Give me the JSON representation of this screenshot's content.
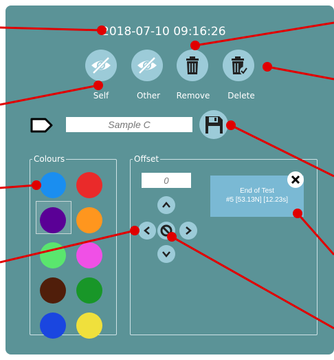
{
  "timestamp": "2018-07-10 09:16:26",
  "toolbar": {
    "self_label": "Self",
    "other_label": "Other",
    "remove_label": "Remove",
    "delete_label": "Delete",
    "self_icon": "eye-slash-icon",
    "other_icon": "eye-slash-icon",
    "remove_icon": "trash-icon",
    "delete_icon": "trash-check-icon"
  },
  "name": {
    "tag_icon": "tag-icon",
    "placeholder": "Sample C",
    "save_icon": "save-icon"
  },
  "colours": {
    "title": "Colours",
    "selected_index": 2,
    "swatches": [
      "#1a8ef0",
      "#ea2a2a",
      "#5a0096",
      "#ff961e",
      "#5ae66e",
      "#f050e6",
      "#501e0a",
      "#189628",
      "#1a46e0",
      "#f0e03c"
    ]
  },
  "offset": {
    "title": "Offset",
    "value": "0",
    "up_icon": "chevron-up-icon",
    "down_icon": "chevron-down-icon",
    "left_icon": "chevron-left-icon",
    "right_icon": "chevron-right-icon",
    "reset_icon": "no-entry-icon"
  },
  "info": {
    "line1": "End of Test",
    "line2": "#5 [53.13N] [12.23s]",
    "close_icon": "close-icon"
  },
  "colors": {
    "panel": "#5b9397",
    "button": "#9ccbd8",
    "info_box": "#7ab9d4",
    "annotation_line": "#e00000"
  }
}
